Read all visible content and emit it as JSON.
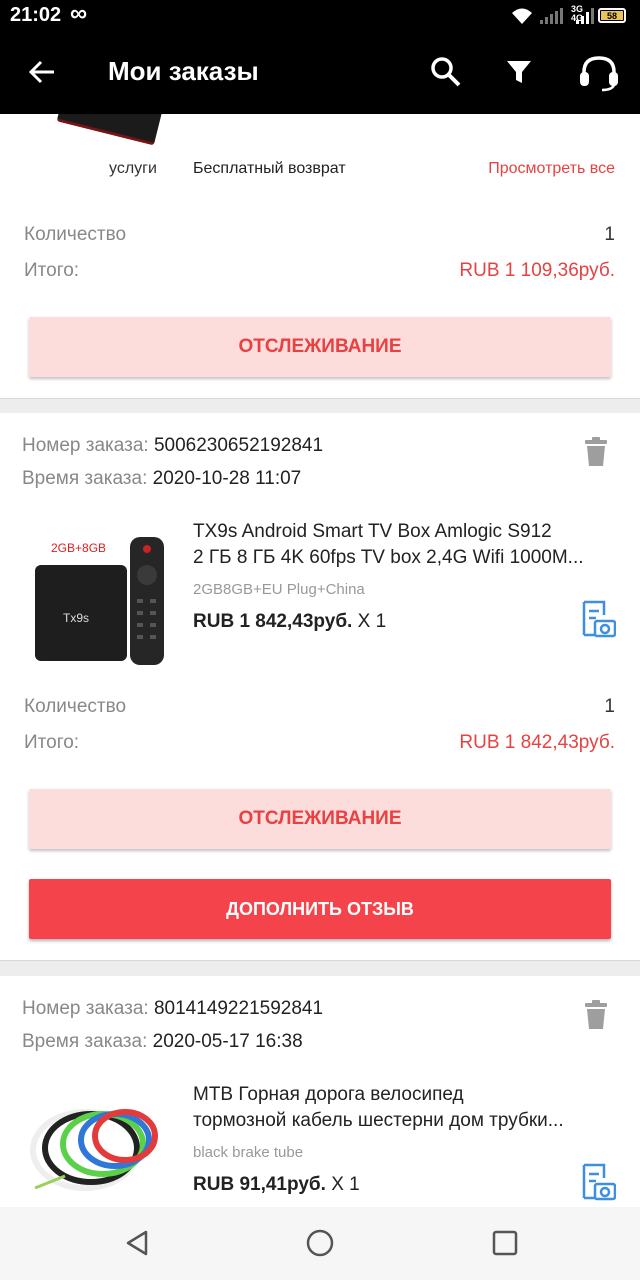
{
  "status_bar": {
    "time": "21:02",
    "infinity": "∞",
    "network": "3G\n4G",
    "battery": "58"
  },
  "app_bar": {
    "title": "Мои заказы"
  },
  "orders": [
    {
      "service_label": "услуги",
      "service_value": "Бесплатный возврат",
      "view_all": "Просмотреть все",
      "quantity_label": "Количество",
      "quantity": "1",
      "total_label": "Итого:",
      "total": "RUB 1 109,36руб.",
      "track_button": "ОТСЛЕЖИВАНИЕ"
    },
    {
      "order_number_label": "Номер заказа:",
      "order_number": "5006230652192841",
      "order_time_label": "Время заказа:",
      "order_time": "2020-10-28 11:07",
      "product_title_line1": "TX9s Android Smart TV Box Amlogic S912",
      "product_title_line2": "2 ГБ 8 ГБ 4K 60fps TV box 2,4G Wifi 1000M...",
      "image_badge": "2GB+8GB",
      "image_brand": "Tx9s",
      "variant": "2GB8GB+EU Plug+China",
      "price": "RUB 1 842,43руб.",
      "multiplier": " X 1",
      "quantity_label": "Количество",
      "quantity": "1",
      "total_label": "Итого:",
      "total": "RUB 1 842,43руб.",
      "track_button": "ОТСЛЕЖИВАНИЕ",
      "review_button": "ДОПОЛНИТЬ ОТЗЫВ"
    },
    {
      "order_number_label": "Номер заказа:",
      "order_number": "8014149221592841",
      "order_time_label": "Время заказа:",
      "order_time": "2020-05-17 16:38",
      "product_title_line1": "MTB Горная дорога велосипед",
      "product_title_line2": "тормозной кабель шестерни дом трубки...",
      "variant": "black brake tube",
      "price": "RUB 91,41руб.",
      "multiplier": " X 1"
    }
  ],
  "colors": {
    "accent": "#e84141",
    "track_bg": "#fddcdc",
    "review_bg": "#f5434b",
    "icon_blue": "#3d8fe0"
  }
}
